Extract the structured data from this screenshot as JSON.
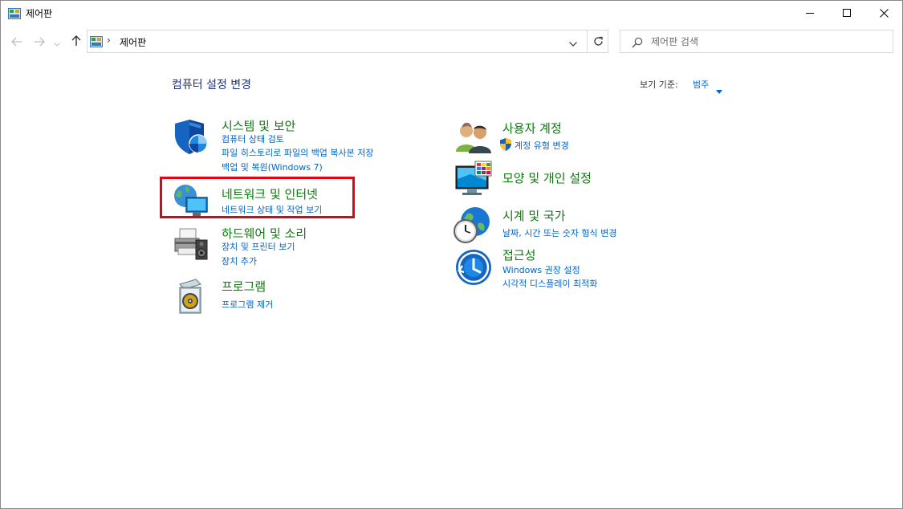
{
  "window": {
    "title": "제어판",
    "controls": {
      "minimize": "minimize-icon",
      "maximize": "maximize-icon",
      "close": "close-icon"
    }
  },
  "address": {
    "separator": "›",
    "crumb": "제어판"
  },
  "search": {
    "placeholder": "제어판 검색"
  },
  "content": {
    "heading": "컴퓨터 설정 변경",
    "view_by_label": "보기 기준:",
    "view_by_value": "범주"
  },
  "categories_left": [
    {
      "title": "시스템 및 보안",
      "icon": "shield-icon",
      "links": [
        "컴퓨터 상태 검토",
        "파일 히스토리로 파일의 백업 복사본 저장",
        "백업 및 복원(Windows 7)"
      ]
    },
    {
      "title": "네트워크 및 인터넷",
      "icon": "network-globe-icon",
      "links": [
        "네트워크 상태 및 작업 보기"
      ]
    },
    {
      "title": "하드웨어 및 소리",
      "icon": "printer-speaker-icon",
      "links": [
        "장치 및 프린터 보기",
        "장치 추가"
      ]
    },
    {
      "title": "프로그램",
      "icon": "programs-disc-icon",
      "links": [
        "프로그램 제거"
      ]
    }
  ],
  "categories_right": [
    {
      "title": "사용자 계정",
      "icon": "users-icon",
      "links": [
        "계정 유형 변경"
      ]
    },
    {
      "title": "모양 및 개인 설정",
      "icon": "monitor-palette-icon",
      "links": []
    },
    {
      "title": "시계 및 국가",
      "icon": "clock-globe-icon",
      "links": [
        "날짜, 시간 또는 숫자 형식 변경"
      ]
    },
    {
      "title": "접근성",
      "icon": "accessibility-icon",
      "links": [
        "Windows 권장 설정",
        "시각적 디스플레이 최적화"
      ]
    }
  ],
  "colors": {
    "category_title": "#0e7a0d",
    "link": "#0066cc",
    "heading": "#1e3287",
    "highlight_border": "#e60012"
  }
}
